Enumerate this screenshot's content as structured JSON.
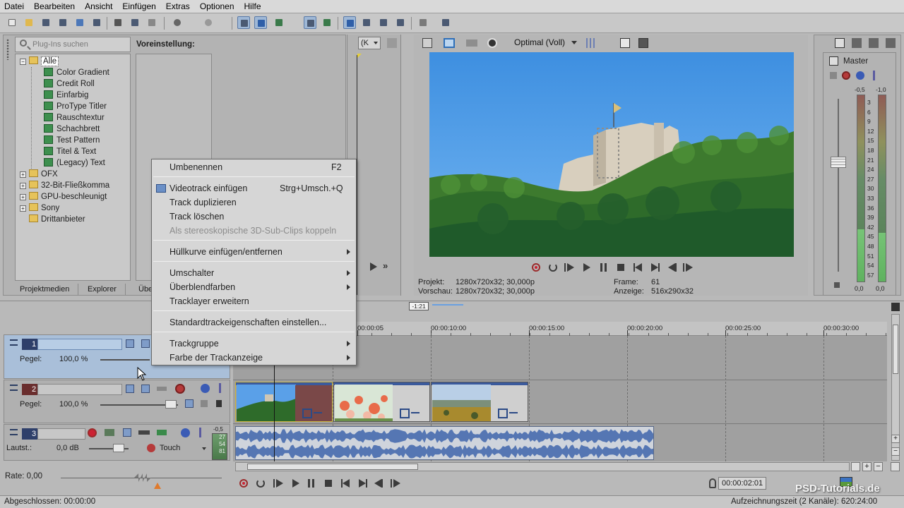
{
  "menubar": [
    "Datei",
    "Bearbeiten",
    "Ansicht",
    "Einfügen",
    "Extras",
    "Optionen",
    "Hilfe"
  ],
  "plugins": {
    "search_placeholder": "Plug-Ins suchen",
    "tree": [
      {
        "label": "Alle",
        "level": 0,
        "selected": true,
        "expanded": true
      },
      {
        "label": "Color Gradient",
        "level": 1
      },
      {
        "label": "Credit Roll",
        "level": 1
      },
      {
        "label": "Einfarbig",
        "level": 1
      },
      {
        "label": "ProType Titler",
        "level": 1
      },
      {
        "label": "Rauschtextur",
        "level": 1
      },
      {
        "label": "Schachbrett",
        "level": 1
      },
      {
        "label": "Test Pattern",
        "level": 1
      },
      {
        "label": "Titel & Text",
        "level": 1
      },
      {
        "label": "(Legacy) Text",
        "level": 1
      },
      {
        "label": "OFX",
        "level": 0
      },
      {
        "label": "32-Bit-Fließkomma",
        "level": 0
      },
      {
        "label": "GPU-beschleunigt",
        "level": 0
      },
      {
        "label": "Sony",
        "level": 0
      },
      {
        "label": "Drittanbieter",
        "level": 0
      }
    ],
    "preset_label": "Voreinstellung:"
  },
  "tabs": [
    "Projektmedien",
    "Explorer",
    "Über"
  ],
  "trimmer": {
    "dropdown": "(K"
  },
  "preview": {
    "quality": "Optimal (Voll)",
    "projekt_label": "Projekt:",
    "projekt_value": "1280x720x32; 30,000p",
    "vorschau_label": "Vorschau:",
    "vorschau_value": "1280x720x32; 30,000p",
    "frame_label": "Frame:",
    "frame_value": "61",
    "anzeige_label": "Anzeige:",
    "anzeige_value": "516x290x32"
  },
  "master": {
    "title": "Master",
    "left_peak": "-0,5",
    "right_peak": "-1,0",
    "scale": [
      "3",
      "6",
      "9",
      "12",
      "15",
      "18",
      "21",
      "24",
      "27",
      "30",
      "33",
      "36",
      "39",
      "42",
      "45",
      "48",
      "51",
      "54",
      "57"
    ],
    "left_bottom": "0,0",
    "right_bottom": "0,0"
  },
  "timeline": {
    "cursor_marker": "-1:21",
    "ruler": [
      "00:00:05",
      "00:00:10:00",
      "00:00:15:00",
      "00:00:20:00",
      "00:00:25:00",
      "00:00:30:00"
    ],
    "tracks": [
      {
        "number": "1",
        "label": "Pegel:",
        "value": "100,0 %",
        "type": "video",
        "selected": true
      },
      {
        "number": "2",
        "label": "Pegel:",
        "value": "100,0 %",
        "type": "video"
      },
      {
        "number": "3",
        "label": "Lautst.:",
        "value": "0,0 dB",
        "type": "audio",
        "mode": "Touch",
        "meter": [
          "-0,5",
          "27",
          "54",
          "81"
        ]
      }
    ],
    "rate_label": "Rate: 0,00",
    "timecode": "00:00:02:01"
  },
  "context_menu": {
    "items": [
      {
        "label": "Umbenennen",
        "shortcut": "F2"
      },
      {
        "label": "Videotrack einfügen",
        "shortcut": "Strg+Umsch.+Q"
      },
      {
        "label": "Track duplizieren"
      },
      {
        "label": "Track löschen"
      },
      {
        "label": "Als stereoskopische 3D-Sub-Clips koppeln",
        "disabled": true
      },
      {
        "label": "Hüllkurve einfügen/entfernen",
        "submenu": true
      },
      {
        "label": "Umschalter",
        "submenu": true
      },
      {
        "label": "Überblendfarben",
        "submenu": true
      },
      {
        "label": "Tracklayer erweitern"
      },
      {
        "label": "Standardtrackeigenschaften einstellen..."
      },
      {
        "label": "Trackgruppe",
        "submenu": true
      },
      {
        "label": "Farbe der Trackanzeige",
        "submenu": true
      }
    ]
  },
  "status": {
    "left": "Abgeschlossen: 00:00:00",
    "right": "Aufzeichnungszeit (2 Kanäle): 620:24:00"
  },
  "watermark": "PSD-Tutorials.de"
}
